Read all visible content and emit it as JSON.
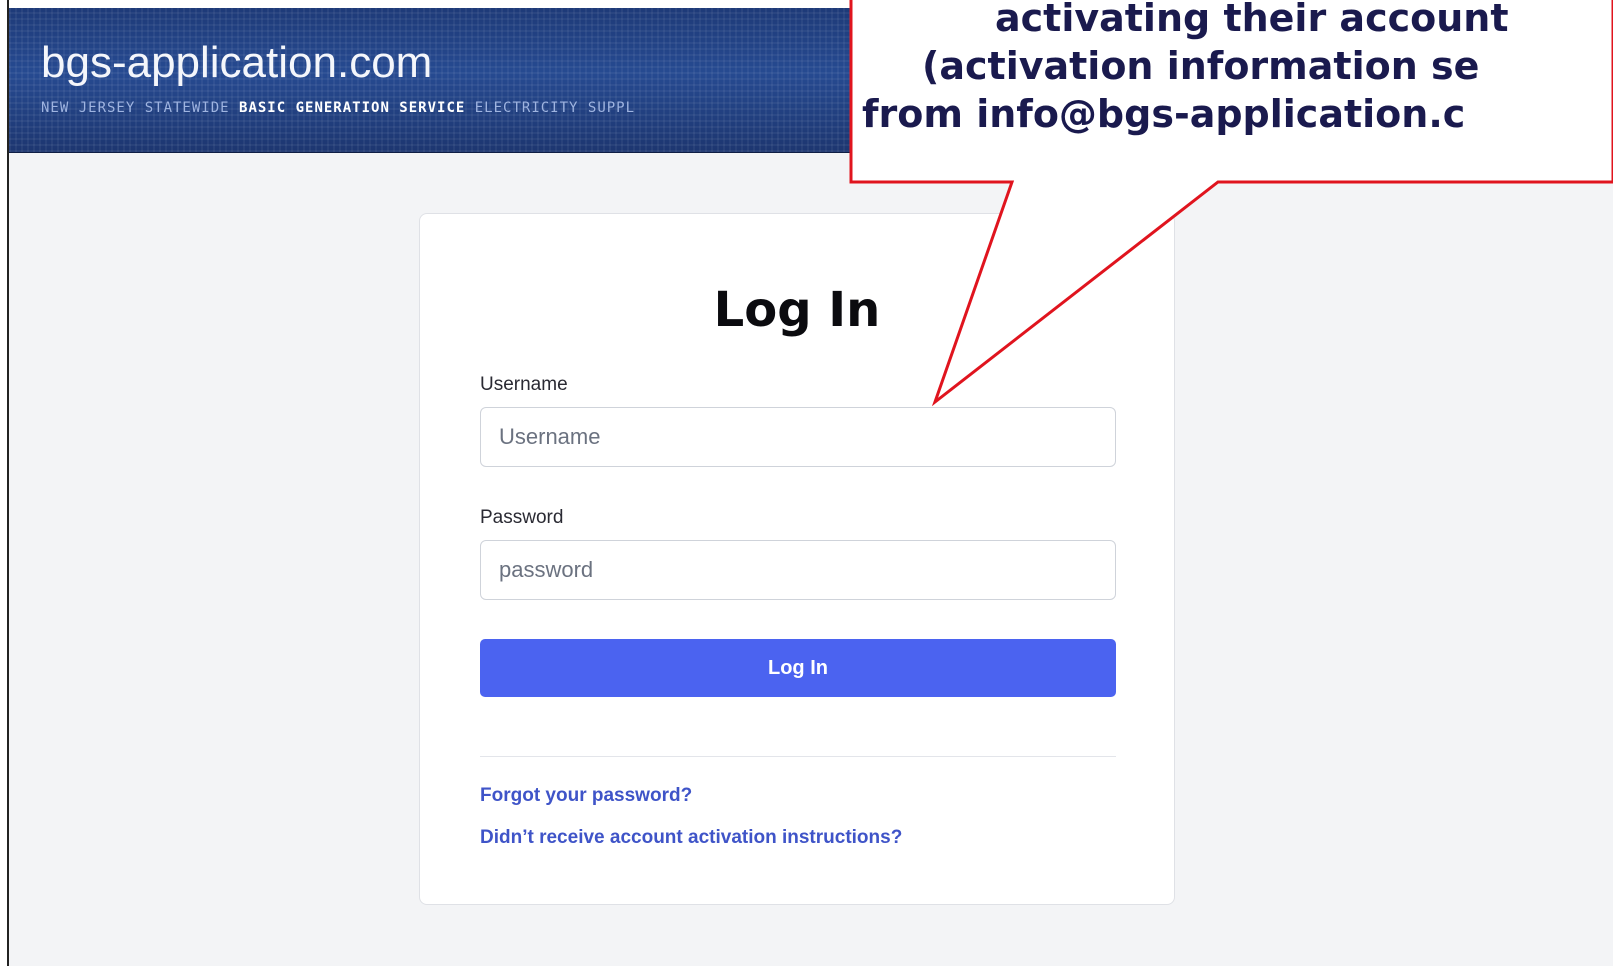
{
  "site": {
    "title": "bgs-application.com",
    "subtitle_parts": [
      {
        "text": "NEW JERSEY STATEWIDE ",
        "bright": false
      },
      {
        "text": "BASIC GENERATION SERVICE",
        "bright": true
      },
      {
        "text": " ELECTRICITY SUPPL",
        "bright": false
      }
    ]
  },
  "login": {
    "title": "Log In",
    "username_label": "Username",
    "username_placeholder": "Username",
    "username_value": "",
    "password_label": "Password",
    "password_placeholder": "password",
    "password_value": "",
    "button_label": "Log In",
    "forgot_link": "Forgot your password?",
    "activation_link": "Didn’t receive account activation instructions?"
  },
  "callout": {
    "lines": [
      "activating their account",
      "(activation information se",
      "from info@bgs-application.c"
    ],
    "border_color": "#e0141e",
    "text_color": "#1a1a4e"
  },
  "colors": {
    "header_bg": "#1e3a78",
    "accent": "#4b63f0",
    "link": "#3f54c8"
  }
}
